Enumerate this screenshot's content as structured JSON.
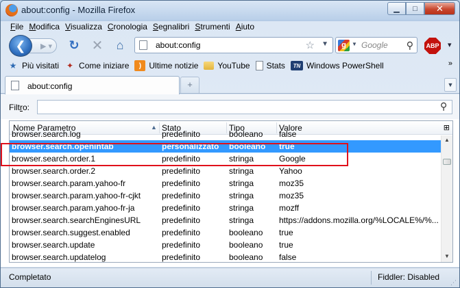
{
  "window": {
    "title": "about:config - Mozilla Firefox"
  },
  "menu": [
    {
      "pre": "",
      "key": "F",
      "post": "ile"
    },
    {
      "pre": "",
      "key": "M",
      "post": "odifica"
    },
    {
      "pre": "",
      "key": "V",
      "post": "isualizza"
    },
    {
      "pre": "",
      "key": "C",
      "post": "ronologia"
    },
    {
      "pre": "",
      "key": "S",
      "post": "egnalibri"
    },
    {
      "pre": "",
      "key": "S",
      "post": "trumenti"
    },
    {
      "pre": "",
      "key": "A",
      "post": "iuto"
    }
  ],
  "navbar": {
    "url": "about:config",
    "search_placeholder": "Google",
    "abp_label": "ABP"
  },
  "bookmarks": [
    {
      "label": "Più visitati",
      "icon": "star-icon"
    },
    {
      "label": "Come iniziare",
      "icon": "dragon-icon"
    },
    {
      "label": "Ultime notizie",
      "icon": "rss-icon"
    },
    {
      "label": "YouTube",
      "icon": "folder-icon"
    },
    {
      "label": "Stats",
      "icon": "page-icon"
    },
    {
      "label": "Windows PowerShell",
      "icon": "tn-icon"
    }
  ],
  "tab": {
    "title": "about:config",
    "new_tab_symbol": "+"
  },
  "filter": {
    "label_pre": "Filt",
    "label_key": "r",
    "label_post": "o:",
    "value": ""
  },
  "table": {
    "columns": [
      "Nome Parametro",
      "Stato",
      "Tipo",
      "Valore"
    ],
    "rows": [
      {
        "name": "browser.search.log",
        "stato": "predefinito",
        "tipo": "booleano",
        "valore": "false",
        "cut": true
      },
      {
        "name": "browser.search.openintab",
        "stato": "personalizzato",
        "tipo": "booleano",
        "valore": "true",
        "selected": true
      },
      {
        "name": "browser.search.order.1",
        "stato": "predefinito",
        "tipo": "stringa",
        "valore": "Google"
      },
      {
        "name": "browser.search.order.2",
        "stato": "predefinito",
        "tipo": "stringa",
        "valore": "Yahoo"
      },
      {
        "name": "browser.search.param.yahoo-fr",
        "stato": "predefinito",
        "tipo": "stringa",
        "valore": "moz35"
      },
      {
        "name": "browser.search.param.yahoo-fr-cjkt",
        "stato": "predefinito",
        "tipo": "stringa",
        "valore": "moz35"
      },
      {
        "name": "browser.search.param.yahoo-fr-ja",
        "stato": "predefinito",
        "tipo": "stringa",
        "valore": "mozff"
      },
      {
        "name": "browser.search.searchEnginesURL",
        "stato": "predefinito",
        "tipo": "stringa",
        "valore": "https://addons.mozilla.org/%LOCALE%/%..."
      },
      {
        "name": "browser.search.suggest.enabled",
        "stato": "predefinito",
        "tipo": "booleano",
        "valore": "true"
      },
      {
        "name": "browser.search.update",
        "stato": "predefinito",
        "tipo": "booleano",
        "valore": "true"
      },
      {
        "name": "browser.search.updatelog",
        "stato": "predefinito",
        "tipo": "booleano",
        "valore": "false"
      }
    ]
  },
  "status": {
    "text": "Completato",
    "fiddler": "Fiddler: Disabled"
  },
  "colors": {
    "selection": "#3399ff",
    "annotation": "#e0101b"
  }
}
